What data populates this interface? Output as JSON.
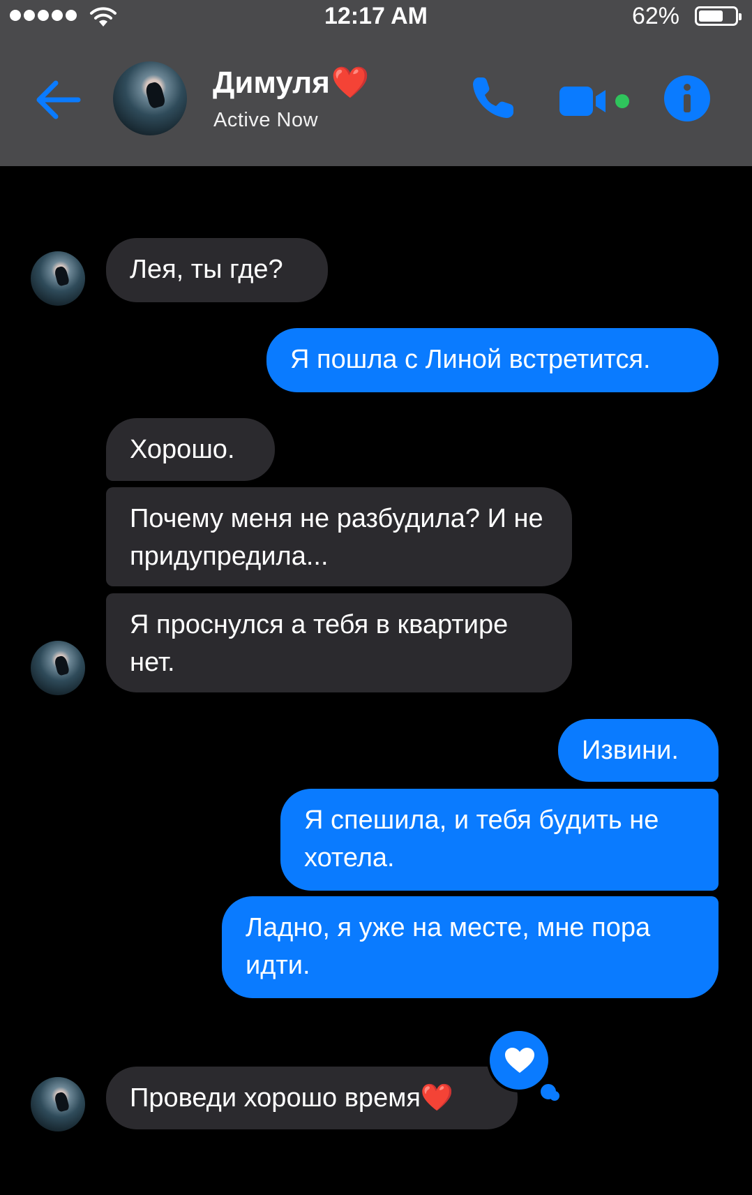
{
  "status_bar": {
    "time": "12:17 AM",
    "battery_percent": "62%",
    "battery_level": 0.62,
    "signal_bars": 5
  },
  "header": {
    "contact_name": "Димуля",
    "name_emoji": "❤️",
    "status": "Active Now",
    "icons": [
      "back-arrow-icon",
      "phone-icon",
      "video-camera-icon",
      "info-icon"
    ],
    "accent_color": "#0a7bff",
    "active_color": "#2fc45c"
  },
  "messages": [
    {
      "side": "incoming",
      "text": "Лея, ты где?"
    },
    {
      "side": "outgoing",
      "text": "Я пошла с Линой встретится."
    },
    {
      "side": "incoming",
      "text": "Хорошо."
    },
    {
      "side": "incoming",
      "text": "Почему меня не разбудила? И не придупредила..."
    },
    {
      "side": "incoming",
      "text": "Я проснулся а тебя в квартире нет."
    },
    {
      "side": "outgoing",
      "text": "Извини."
    },
    {
      "side": "outgoing",
      "text": "Я спешила, и тебя будить не хотела."
    },
    {
      "side": "outgoing",
      "text": "Ладно, я уже на месте, мне пора идти."
    },
    {
      "side": "incoming",
      "text": "Проведи хорошо время",
      "emoji": "❤️",
      "reaction": "heart-icon"
    }
  ]
}
